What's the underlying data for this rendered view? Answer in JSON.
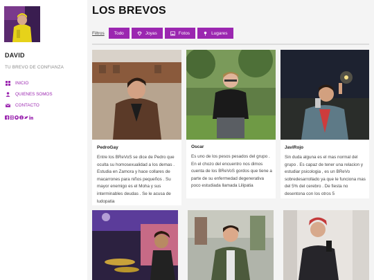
{
  "site": {
    "name": "DAVID",
    "tagline": "TU BREVO DE CONFIANZA"
  },
  "nav": [
    {
      "label": "INICIO",
      "icon": "grid-icon"
    },
    {
      "label": "QUIENES SOMOS",
      "icon": "user-icon"
    },
    {
      "label": "CONTACTO",
      "icon": "envelope-icon"
    }
  ],
  "socials": [
    "facebook-icon",
    "instagram-icon",
    "github-icon",
    "pinterest-icon",
    "twitter-icon",
    "linkedin-icon"
  ],
  "page": {
    "title": "LOS BREVOS"
  },
  "filters": {
    "label": "Filtros",
    "buttons": [
      {
        "label": "Todo",
        "icon": ""
      },
      {
        "label": "Joyas",
        "icon": "diamond-icon"
      },
      {
        "label": "Fotos",
        "icon": "image-icon"
      },
      {
        "label": "Lugares",
        "icon": "pin-icon"
      }
    ]
  },
  "cards": [
    {
      "name": "PedroGay",
      "text": "Entre los BReVoS se dice de Pedro que oculta su homosexualidad a los demas . Estudia en Zamora y hace collares de macarrones para niños pequeños . Su mayor enemigo es el Moha y sus interminables deudas . Se le acusa de ludopatia"
    },
    {
      "name": "Oscar",
      "text": "Es uno de los pesos pesados del grupo . En el chozo del encuentro nos dimos cuenta de los BReVoS gordos que tiene a parte de su enfermedad degenerativa poco estudiada llamada Lilipatia"
    },
    {
      "name": "JaviRojo",
      "text": "Sin duda alguna es el mas normal del grupo . Es capaz de tener una relacion y estudiar psicologia , es un BReVo sobredesarrollado ya que le funciona mas del 5% del cerebro . De fiesta no desentona con los otros 5"
    },
    {
      "name": "",
      "text": ""
    },
    {
      "name": "",
      "text": ""
    },
    {
      "name": "",
      "text": ""
    }
  ],
  "colors": {
    "accent": "#9b27b0",
    "background": "#f4f4f4"
  }
}
